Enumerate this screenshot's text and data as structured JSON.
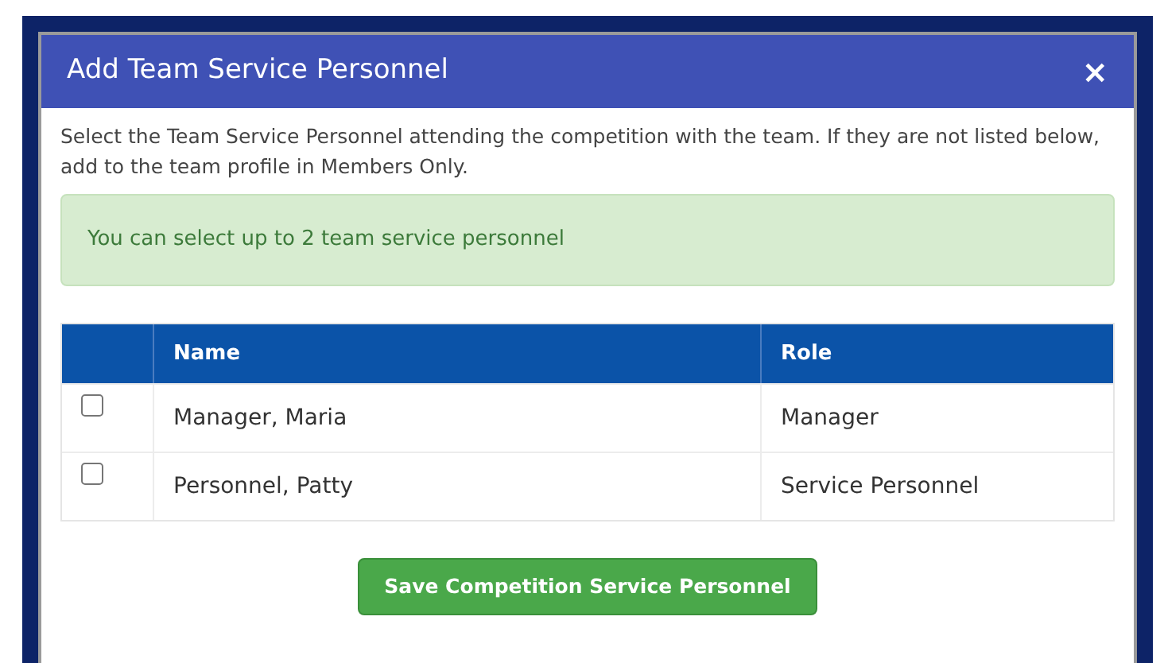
{
  "dialog": {
    "title": "Add Team Service Personnel",
    "close": "×",
    "description": "Select the Team Service Personnel attending the competition with the team. If they are not listed below, add to the team profile in Members Only.",
    "notice": "You can select up to 2 team service personnel"
  },
  "table": {
    "columns": [
      "Name",
      "Role"
    ],
    "rows": [
      {
        "name": "Manager, Maria",
        "role": "Manager",
        "checked": false
      },
      {
        "name": "Personnel, Patty",
        "role": "Service Personnel",
        "checked": false
      }
    ]
  },
  "buttons": [
    "Save Competition Service Personnel"
  ]
}
